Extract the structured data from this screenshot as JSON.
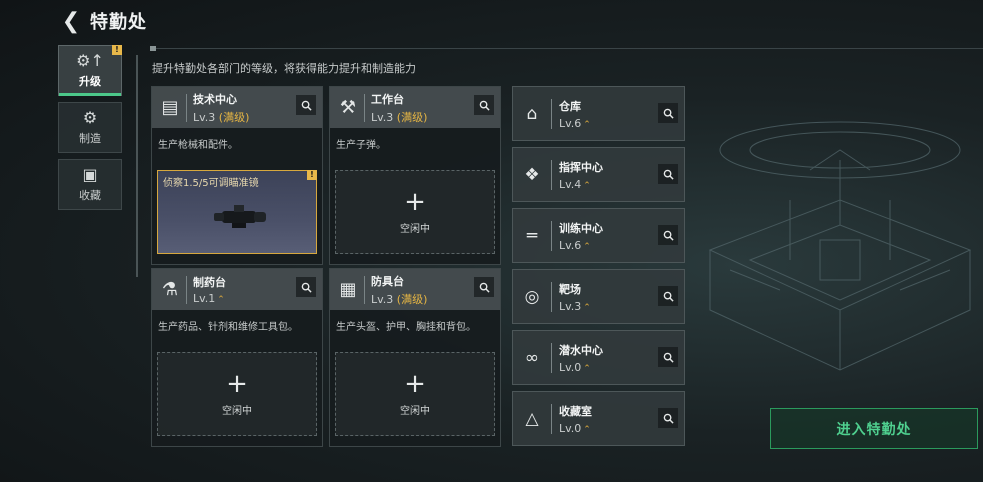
{
  "header": {
    "title": "特勤处",
    "back_icon": "back-arrow-icon"
  },
  "subtitle": "提升特勤处各部门的等级，将获得能力提升和制造能力",
  "sidebar": {
    "items": [
      {
        "label": "升级",
        "icon": "upgrade-icon",
        "active": true,
        "badge": "!"
      },
      {
        "label": "制造",
        "icon": "gears-icon",
        "active": false
      },
      {
        "label": "收藏",
        "icon": "collection-icon",
        "active": false
      }
    ]
  },
  "workstations": [
    {
      "name": "技术中心",
      "level": "Lv.3",
      "status": "(满级)",
      "desc": "生产枪械和配件。",
      "crafting": {
        "label": "侦察1.5/5可调瞄准镜",
        "badge": "!"
      }
    },
    {
      "name": "工作台",
      "level": "Lv.3",
      "status": "(满级)",
      "desc": "生产子弹。",
      "idle_label": "空闲中"
    },
    {
      "name": "制药台",
      "level": "Lv.1",
      "desc": "生产药品、针剂和维修工具包。",
      "idle_label": "空闲中"
    },
    {
      "name": "防具台",
      "level": "Lv.3",
      "status": "(满级)",
      "desc": "生产头盔、护甲、胸挂和背包。",
      "idle_label": "空闲中"
    }
  ],
  "rooms": [
    {
      "name": "仓库",
      "level": "Lv.6"
    },
    {
      "name": "指挥中心",
      "level": "Lv.4"
    },
    {
      "name": "训练中心",
      "level": "Lv.6"
    },
    {
      "name": "靶场",
      "level": "Lv.3"
    },
    {
      "name": "潜水中心",
      "level": "Lv.0"
    },
    {
      "name": "收藏室",
      "level": "Lv.0"
    }
  ],
  "plus_symbol": "+",
  "upgrade_symbol": "⌃",
  "enter_button": "进入特勤处",
  "colors": {
    "accent_green": "#4fd08f",
    "maxed_gold": "#e5b544",
    "badge_yellow": "#e8b84a"
  }
}
